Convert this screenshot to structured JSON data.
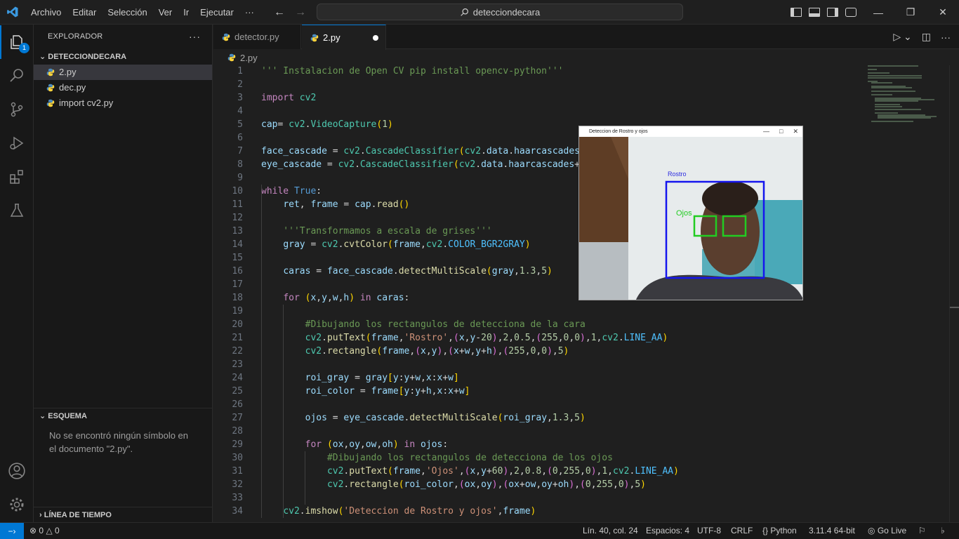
{
  "titlebar": {
    "menu": [
      "Archivo",
      "Editar",
      "Selección",
      "Ver",
      "Ir",
      "Ejecutar"
    ],
    "more": "···",
    "search": "detecciondecara"
  },
  "activity": {
    "explorer_badge": "1"
  },
  "sidebar": {
    "title": "EXPLORADOR",
    "more": "···",
    "folder": "DETECCIONDECARA",
    "files": [
      "2.py",
      "dec.py",
      "import cv2.py"
    ],
    "outline_title": "ESQUEMA",
    "outline_message": "No se encontró ningún símbolo en el documento \"2.py\".",
    "timeline_title": "LÍNEA DE TIEMPO"
  },
  "tabs": [
    {
      "label": "detector.py"
    },
    {
      "label": "2.py"
    }
  ],
  "breadcrumb": "2.py",
  "camera_window": {
    "title": "Deteccion de Rostro y ojos",
    "face_label": "Rostro",
    "eyes_label": "Ojos"
  },
  "statusbar": {
    "problems": "0",
    "warnings": "0",
    "position": "Lín. 40, col. 24",
    "spaces": "Espacios: 4",
    "encoding": "UTF-8",
    "eol": "CRLF",
    "language": "Python",
    "interpreter": "3.11.4 64-bit",
    "golive": "Go Live"
  },
  "code_lines": [
    {
      "n": "1",
      "text": "''' Instalacion de Open CV pip install opencv-python'''"
    },
    {
      "n": "2",
      "text": ""
    },
    {
      "n": "3",
      "text": "import cv2"
    },
    {
      "n": "4",
      "text": ""
    },
    {
      "n": "5",
      "text": "cap= cv2.VideoCapture(1)"
    },
    {
      "n": "6",
      "text": ""
    },
    {
      "n": "7",
      "text": "face_cascade = cv2.CascadeClassifier(cv2.data.haarcascades+"
    },
    {
      "n": "8",
      "text": "eye_cascade = cv2.CascadeClassifier(cv2.data.haarcascades+'"
    },
    {
      "n": "9",
      "text": ""
    },
    {
      "n": "10",
      "text": "while True:"
    },
    {
      "n": "11",
      "text": "    ret, frame = cap.read()"
    },
    {
      "n": "12",
      "text": ""
    },
    {
      "n": "13",
      "text": "    '''Transformamos a escala de grises'''"
    },
    {
      "n": "14",
      "text": "    gray = cv2.cvtColor(frame,cv2.COLOR_BGR2GRAY)"
    },
    {
      "n": "15",
      "text": ""
    },
    {
      "n": "16",
      "text": "    caras = face_cascade.detectMultiScale(gray,1.3,5)"
    },
    {
      "n": "17",
      "text": ""
    },
    {
      "n": "18",
      "text": "    for (x,y,w,h) in caras:"
    },
    {
      "n": "19",
      "text": ""
    },
    {
      "n": "20",
      "text": "        #Dibujando los rectangulos de detecciona de la cara"
    },
    {
      "n": "21",
      "text": "        cv2.putText(frame,'Rostro',(x,y-20),2,0.5,(255,0,0),1,cv2.LINE_AA)"
    },
    {
      "n": "22",
      "text": "        cv2.rectangle(frame,(x,y),(x+w,y+h),(255,0,0),5)"
    },
    {
      "n": "23",
      "text": ""
    },
    {
      "n": "24",
      "text": "        roi_gray = gray[y:y+w,x:x+w]"
    },
    {
      "n": "25",
      "text": "        roi_color = frame[y:y+h,x:x+w]"
    },
    {
      "n": "26",
      "text": ""
    },
    {
      "n": "27",
      "text": "        ojos = eye_cascade.detectMultiScale(roi_gray,1.3,5)"
    },
    {
      "n": "28",
      "text": ""
    },
    {
      "n": "29",
      "text": "        for (ox,oy,ow,oh) in ojos:"
    },
    {
      "n": "30",
      "text": "            #Dibujando los rectangulos de detecciona de los ojos"
    },
    {
      "n": "31",
      "text": "            cv2.putText(frame,'Ojos',(x,y+60),2,0.8,(0,255,0),1,cv2.LINE_AA)"
    },
    {
      "n": "32",
      "text": "            cv2.rectangle(roi_color,(ox,oy),(ox+ow,oy+oh),(0,255,0),5)"
    },
    {
      "n": "33",
      "text": ""
    },
    {
      "n": "34",
      "text": "    cv2.imshow('Deteccion de Rostro y ojos',frame)"
    }
  ]
}
